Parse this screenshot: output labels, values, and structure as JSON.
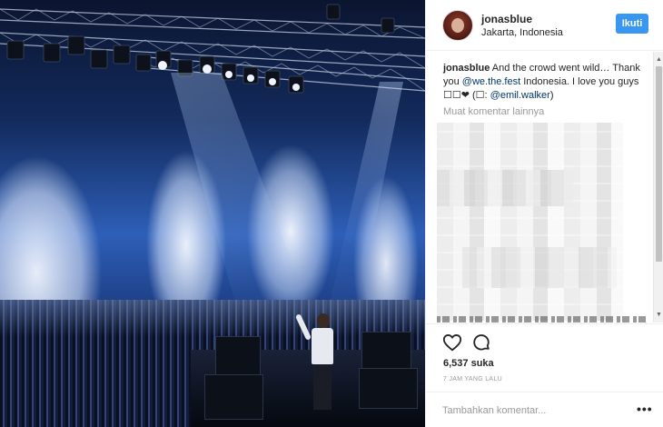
{
  "post": {
    "username": "jonasblue",
    "location": "Jakarta, Indonesia",
    "follow_label": "Ikuti"
  },
  "caption": {
    "username": "jonasblue",
    "text_1": " And the crowd went wild… Thank you ",
    "mention_1": "@we.the.fest",
    "text_2": " Indonesia. I love you guys ",
    "emoji": "☐☐❤",
    "text_3": " (☐: ",
    "mention_2": "@emil.walker",
    "text_4": ")"
  },
  "comments": {
    "load_more_label": "Muat komentar lainnya"
  },
  "actions": {
    "like_icon": "heart-outline-icon",
    "comment_icon": "comment-bubble-icon",
    "likes_text": "6,537 suka",
    "time_text": "7 JAM YANG LALU"
  },
  "add_comment": {
    "placeholder": "Tambahkan komentar...",
    "more_label": "•••"
  },
  "colors": {
    "accent": "#3897f0",
    "mention": "#003569",
    "muted": "#999999"
  }
}
